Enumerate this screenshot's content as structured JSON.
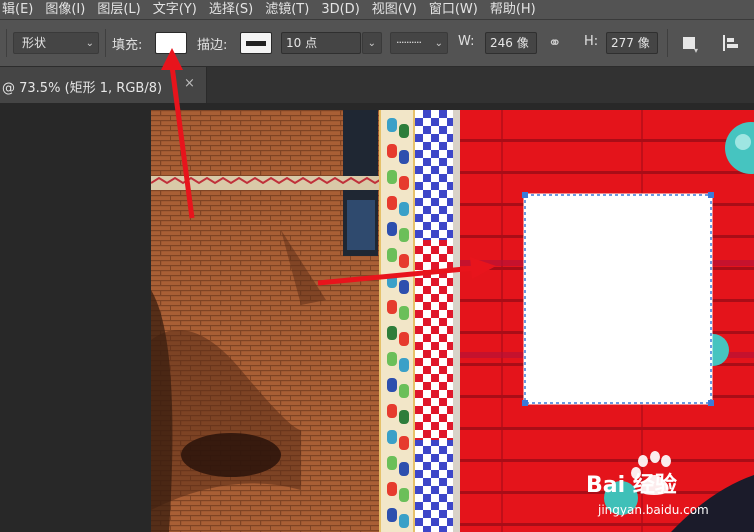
{
  "menubar": {
    "items": [
      "辑(E)",
      "图像(I)",
      "图层(L)",
      "文字(Y)",
      "选择(S)",
      "滤镜(T)",
      "3D(D)",
      "视图(V)",
      "窗口(W)",
      "帮助(H)"
    ]
  },
  "options": {
    "mode": "形状",
    "fill_label": "填充:",
    "fill_color": "#ffffff",
    "stroke_label": "描边:",
    "stroke_width": "10 点",
    "w_label": "W:",
    "w_value": "246 像",
    "h_label": "H:",
    "h_value": "277 像"
  },
  "document": {
    "tab_title": "@ 73.5% (矩形 1, RGB/8)",
    "close_glyph": "×"
  },
  "watermark": {
    "brand": "Bai 经验",
    "url": "jingyan.baidu.com"
  },
  "colors": {
    "accent_arrow": "#e8141c",
    "selection": "#3b7ad9"
  }
}
